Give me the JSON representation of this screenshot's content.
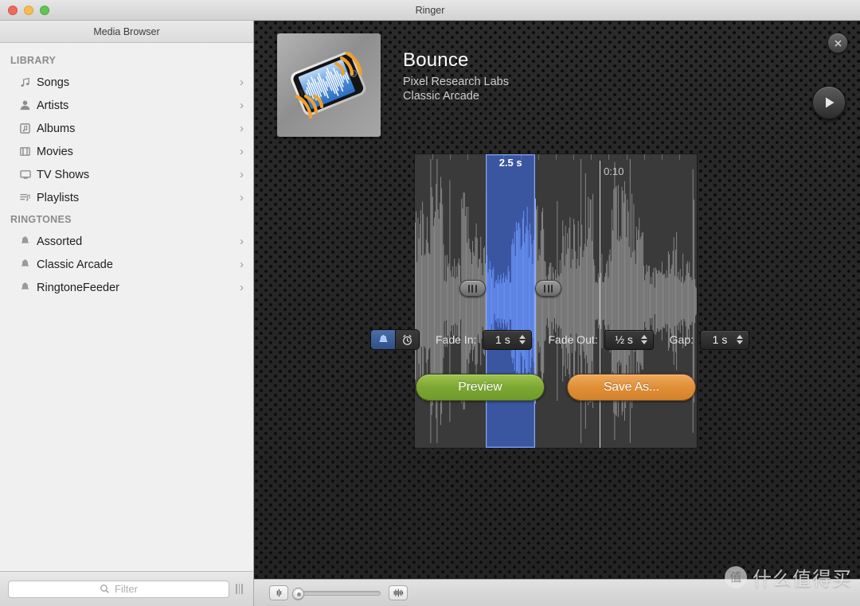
{
  "window": {
    "title": "Ringer",
    "traffic_lights": [
      "close",
      "minimize",
      "zoom"
    ]
  },
  "sidebar": {
    "header": "Media Browser",
    "groups": [
      {
        "label": "LIBRARY",
        "items": [
          {
            "label": "Songs",
            "icon": "music-note-icon"
          },
          {
            "label": "Artists",
            "icon": "person-icon"
          },
          {
            "label": "Albums",
            "icon": "album-icon"
          },
          {
            "label": "Movies",
            "icon": "film-icon"
          },
          {
            "label": "TV Shows",
            "icon": "tv-icon"
          },
          {
            "label": "Playlists",
            "icon": "playlist-icon"
          }
        ]
      },
      {
        "label": "RINGTONES",
        "items": [
          {
            "label": "Assorted",
            "icon": "bell-icon"
          },
          {
            "label": "Classic Arcade",
            "icon": "bell-icon"
          },
          {
            "label": "RingtoneFeeder",
            "icon": "bell-icon"
          }
        ]
      }
    ],
    "filter": {
      "placeholder": "Filter",
      "value": "",
      "icon": "search-icon"
    }
  },
  "track": {
    "name": "Bounce",
    "artist": "Pixel Research Labs",
    "album": "Classic Arcade",
    "artwork_alt": "iphone-waveform-artwork"
  },
  "waveform": {
    "selection_duration": "2.5 s",
    "time_marker": "0:10",
    "selection_start_pct": 25.2,
    "selection_width_pct": 17.5,
    "playhead_pct": 65.5,
    "time_label_pct": 67.0
  },
  "controls": {
    "mode_toggle": {
      "options": [
        "bell-icon",
        "alarm-clock-icon"
      ],
      "selected_index": 0
    },
    "fade_in": {
      "label": "Fade In:",
      "value": "1 s"
    },
    "fade_out": {
      "label": "Fade Out:",
      "value": "½ s"
    },
    "gap": {
      "label": "Gap:",
      "value": "1 s"
    }
  },
  "actions": {
    "preview": "Preview",
    "save_as": "Save As..."
  },
  "bottom_bar": {
    "zoom_out_icon": "waveform-zoom-out-icon",
    "zoom_in_icon": "waveform-zoom-in-icon",
    "zoom_value_pct": 0
  },
  "watermark": {
    "logo_glyph": "值",
    "text": "什么值得买"
  },
  "colors": {
    "selection_blue": "#3c6ef5",
    "selection_border": "#7ea6ff",
    "preview_green": "#7da734",
    "save_orange": "#e08f38",
    "panel_dark": "#242424",
    "waveform_gray": "#8a8a8a",
    "waveform_blue": "#9dbdf5"
  }
}
